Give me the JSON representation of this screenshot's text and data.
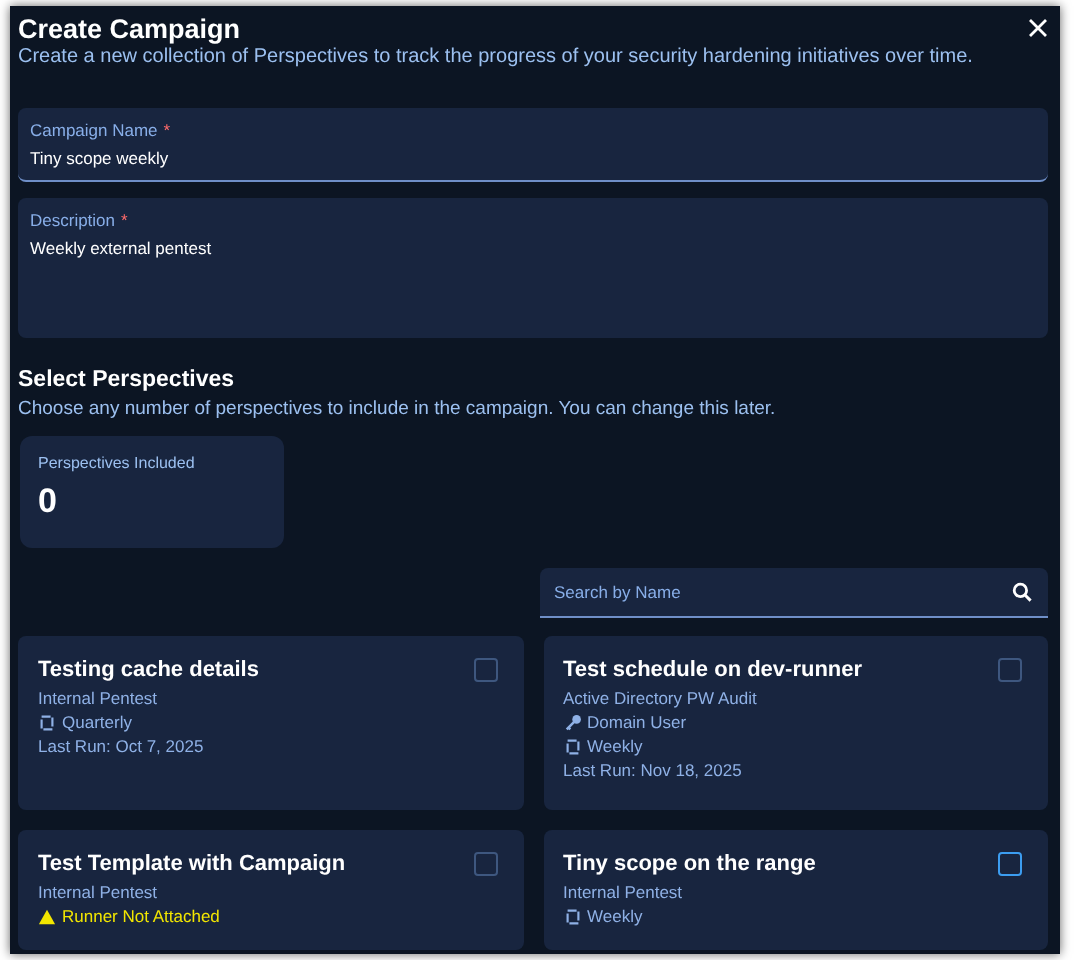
{
  "dialog": {
    "title": "Create Campaign",
    "subtitle": "Create a new collection of Perspectives to track the progress of your security hardening initiatives over time."
  },
  "fields": [
    {
      "label": "Campaign Name",
      "required_mark": "*",
      "value": "Tiny scope weekly",
      "kind": "text"
    },
    {
      "label": "Description",
      "required_mark": "*",
      "value": "Weekly external pentest",
      "kind": "textarea"
    }
  ],
  "section": {
    "title": "Select Perspectives",
    "subtitle": "Choose any number of perspectives to include in the campaign. You can change this later."
  },
  "counter": {
    "label": "Perspectives Included",
    "value": "0"
  },
  "search": {
    "placeholder": "Search by Name"
  },
  "cards": [
    {
      "title": "Testing cache details",
      "type": "Internal Pentest",
      "checked": false,
      "hovered": false,
      "lines": [
        {
          "kind": "schedule",
          "text": "Quarterly"
        },
        {
          "kind": "last_run",
          "text": "Last Run: Oct 7, 2025"
        }
      ]
    },
    {
      "title": "Test schedule on dev-runner",
      "type": "Active Directory PW Audit",
      "checked": false,
      "hovered": false,
      "lines": [
        {
          "kind": "credential",
          "text": "Domain User"
        },
        {
          "kind": "schedule",
          "text": "Weekly"
        },
        {
          "kind": "last_run",
          "text": "Last Run: Nov 18, 2025"
        }
      ]
    },
    {
      "title": "Test Template with Campaign",
      "type": "Internal Pentest",
      "checked": false,
      "hovered": false,
      "lines": [
        {
          "kind": "warning",
          "text": "Runner Not Attached"
        }
      ]
    },
    {
      "title": "Tiny scope on the range",
      "type": "Internal Pentest",
      "checked": false,
      "hovered": true,
      "lines": [
        {
          "kind": "schedule",
          "text": "Weekly"
        }
      ]
    }
  ]
}
